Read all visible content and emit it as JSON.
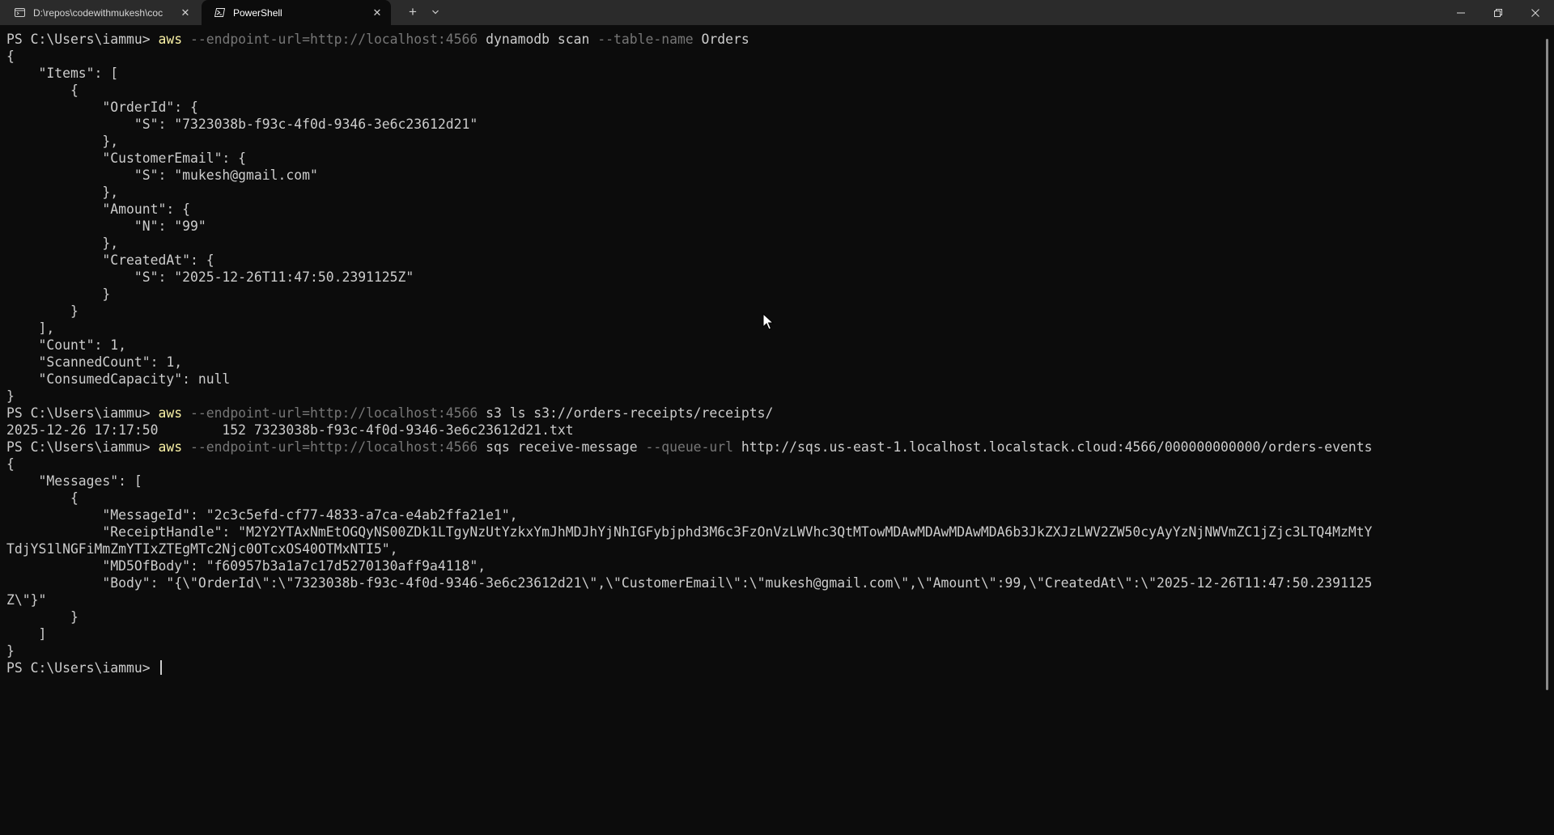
{
  "window": {
    "tabs": [
      {
        "title": "D:\\repos\\codewithmukesh\\coc",
        "icon": "folder-terminal-icon",
        "active": false
      },
      {
        "title": "PowerShell",
        "icon": "powershell-icon",
        "active": true
      }
    ],
    "new_tab_symbol": "+",
    "close_symbol": "✕"
  },
  "terminal": {
    "prompt": "PS C:\\Users\\iammu> ",
    "commands": [
      {
        "exe": "aws",
        "parts": [
          {
            "text": " --endpoint-url=http://localhost:4566",
            "kind": "param"
          },
          {
            "text": " dynamodb scan",
            "kind": "arg"
          },
          {
            "text": " --table-name",
            "kind": "param"
          },
          {
            "text": " Orders",
            "kind": "arg"
          }
        ],
        "output": [
          "{",
          "    \"Items\": [",
          "        {",
          "            \"OrderId\": {",
          "                \"S\": \"7323038b-f93c-4f0d-9346-3e6c23612d21\"",
          "            },",
          "            \"CustomerEmail\": {",
          "                \"S\": \"mukesh@gmail.com\"",
          "            },",
          "            \"Amount\": {",
          "                \"N\": \"99\"",
          "            },",
          "            \"CreatedAt\": {",
          "                \"S\": \"2025-12-26T11:47:50.2391125Z\"",
          "            }",
          "        }",
          "    ],",
          "    \"Count\": 1,",
          "    \"ScannedCount\": 1,",
          "    \"ConsumedCapacity\": null",
          "}"
        ]
      },
      {
        "exe": "aws",
        "parts": [
          {
            "text": " --endpoint-url=http://localhost:4566",
            "kind": "param"
          },
          {
            "text": " s3 ls s3://orders-receipts/receipts/",
            "kind": "arg"
          }
        ],
        "output": [
          "2025-12-26 17:17:50        152 7323038b-f93c-4f0d-9346-3e6c23612d21.txt"
        ]
      },
      {
        "exe": "aws",
        "parts": [
          {
            "text": " --endpoint-url=http://localhost:4566",
            "kind": "param"
          },
          {
            "text": " sqs receive-message",
            "kind": "arg"
          },
          {
            "text": " --queue-url",
            "kind": "param"
          },
          {
            "text": " http://sqs.us-east-1.localhost.localstack.cloud:4566/000000000000/orders-events",
            "kind": "arg"
          }
        ],
        "output": [
          "{",
          "    \"Messages\": [",
          "        {",
          "            \"MessageId\": \"2c3c5efd-cf77-4833-a7ca-e4ab2ffa21e1\",",
          "            \"ReceiptHandle\": \"M2Y2YTAxNmEtOGQyNS00ZDk1LTgyNzUtYzkxYmJhMDJhYjNhIGFybjphd3M6c3FzOnVzLWVhc3QtMTowMDAwMDAwMDAwMDA6b3JkZXJzLWV2ZW50cyAyYzNjNWVmZC1jZjc3LTQ4MzMtY",
          "TdjYS1lNGFiMmZmYTIxZTEgMTc2Njc0OTcxOS40OTMxNTI5\",",
          "            \"MD5OfBody\": \"f60957b3a1a7c17d5270130aff9a4118\",",
          "            \"Body\": \"{\\\"OrderId\\\":\\\"7323038b-f93c-4f0d-9346-3e6c23612d21\\\",\\\"CustomerEmail\\\":\\\"mukesh@gmail.com\\\",\\\"Amount\\\":99,\\\"CreatedAt\\\":\\\"2025-12-26T11:47:50.2391125",
          "Z\\\"}\"",
          "        }",
          "    ]",
          "}"
        ]
      }
    ]
  }
}
